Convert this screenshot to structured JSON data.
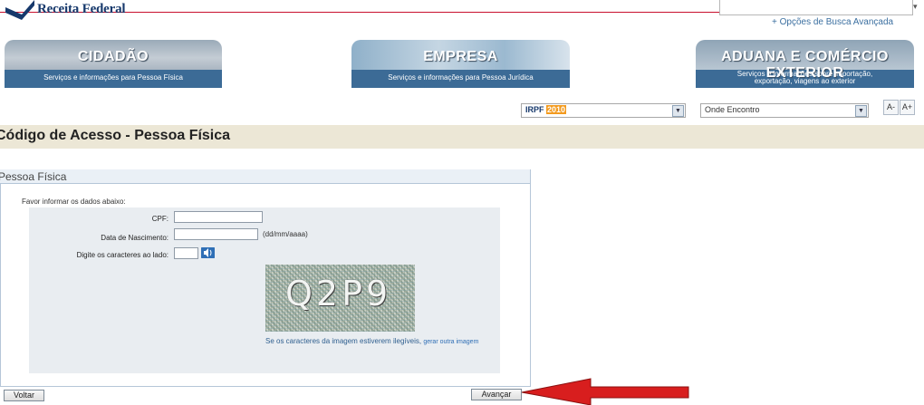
{
  "header": {
    "logo_text": "Receita Federal",
    "advanced_search": "+ Opções de Busca Avançada"
  },
  "banners": [
    {
      "title": "CIDADÃO",
      "subtitle": "Serviços e informações para Pessoa Física"
    },
    {
      "title": "EMPRESA",
      "subtitle": "Serviços e informações para Pessoa Jurídica"
    },
    {
      "title": "ADUANA E COMÉRCIO EXTERIOR",
      "subtitle_line1": "Serviços e informações sobre importação,",
      "subtitle_line2": "exportação, viagens ao exterior"
    }
  ],
  "toolbar": {
    "irpf_label": "IRPF",
    "irpf_year": "2010",
    "onde_encontro": "Onde Encontro",
    "font_decrease": "A-",
    "font_increase": "A+"
  },
  "page": {
    "title": "Código de Acesso - Pessoa Física"
  },
  "form": {
    "panel_title": "Pessoa Física",
    "intro": "Favor informar os dados abaixo:",
    "cpf_label": "CPF:",
    "cpf_value": "",
    "birth_label": "Data de Nascimento:",
    "birth_value": "",
    "birth_hint": "(dd/mm/aaaa)",
    "captcha_label": "Digite os caracteres ao lado:",
    "captcha_value": "",
    "captcha_chars": "Q2P9",
    "illegible_text": "Se os caracteres da imagem estiverem ilegíveis,",
    "regenerate_link": "gerar outra imagem"
  },
  "buttons": {
    "back": "Voltar",
    "next": "Avançar"
  },
  "colors": {
    "brand_blue": "#16386b",
    "accent_orange": "#f39a1e",
    "annotation_arrow": "#d81e1e"
  }
}
